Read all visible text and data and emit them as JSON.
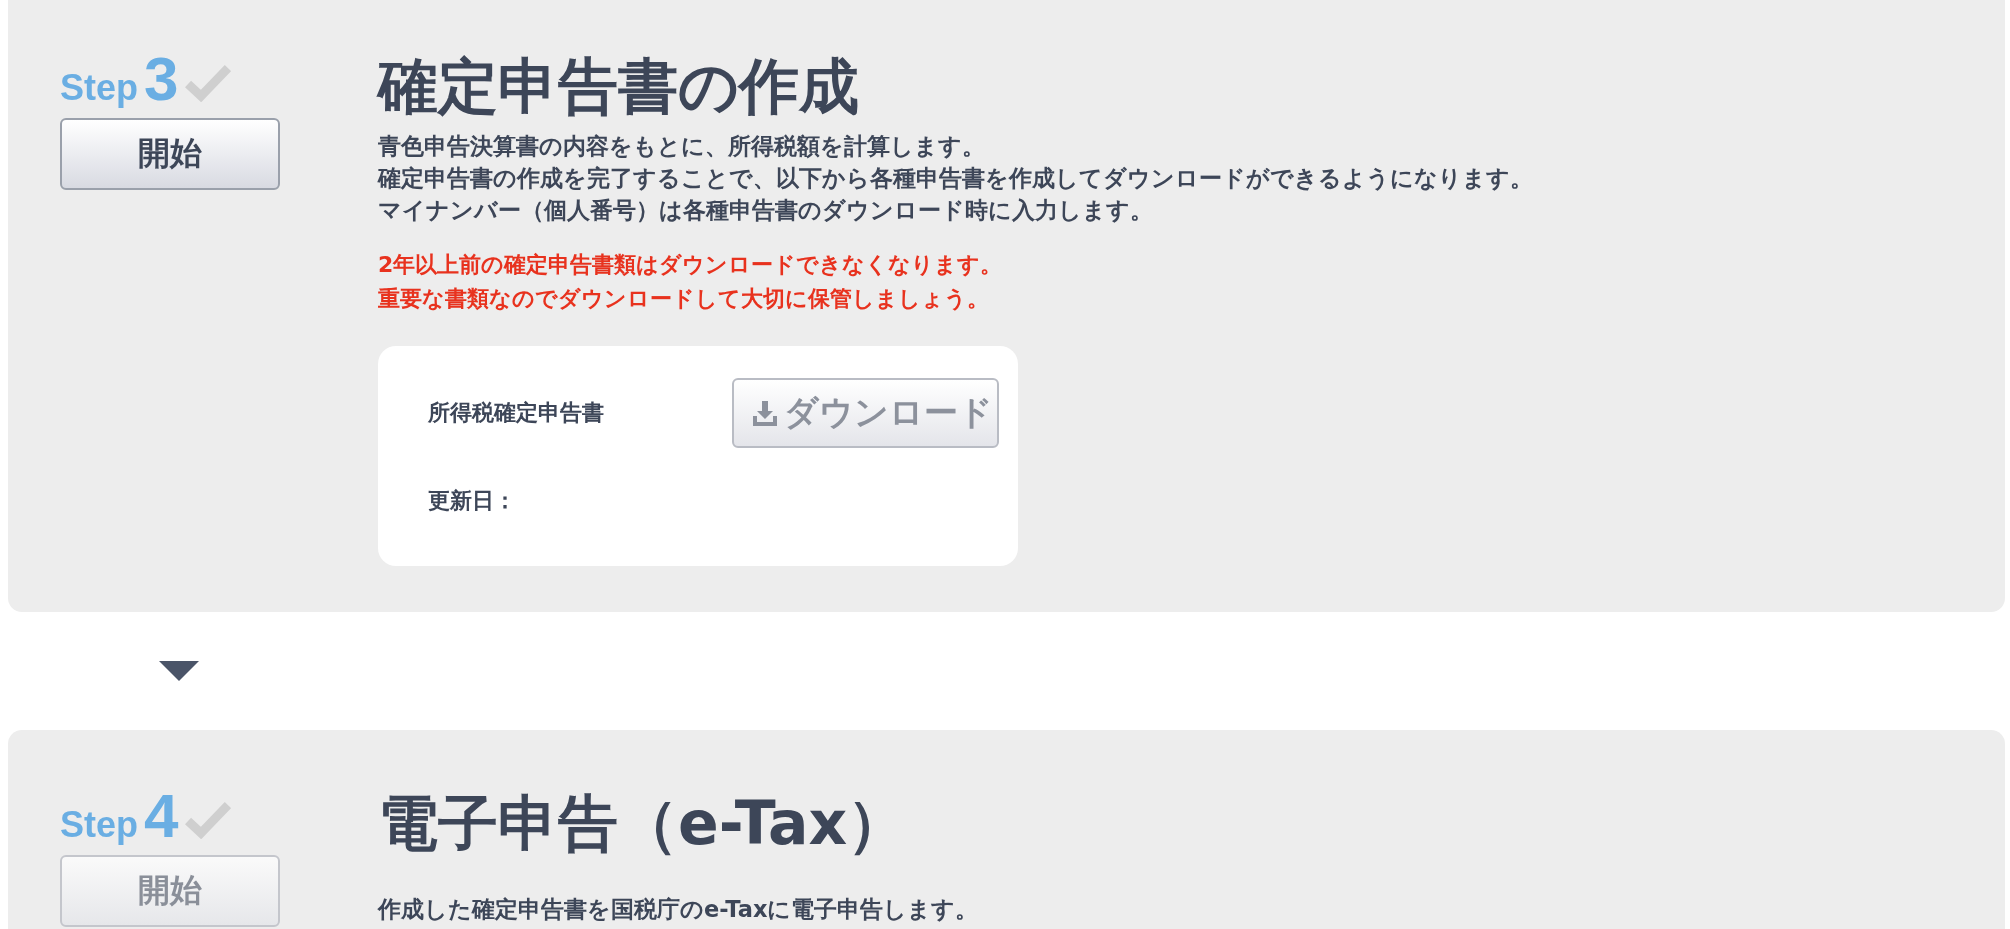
{
  "steps": [
    {
      "step_label": "Step",
      "number": "3",
      "completed": false,
      "start_button": {
        "label": "開始",
        "disabled": false
      },
      "title": "確定申告書の作成",
      "description": [
        "青色申告決算書の内容をもとに、所得税額を計算します。",
        "確定申告書の作成を完了することで、以下から各種申告書を作成してダウンロードができるようになります。",
        "マイナンバー（個人番号）は各種申告書のダウンロード時に入力します。"
      ],
      "warnings": [
        "2年以上前の確定申告書類はダウンロードできなくなります。",
        "重要な書類なのでダウンロードして大切に保管しましょう。"
      ],
      "documents": [
        {
          "name": "所得税確定申告書",
          "updated_label": "更新日：",
          "download": {
            "label": "ダウンロード",
            "disabled": true
          }
        }
      ]
    },
    {
      "step_label": "Step",
      "number": "4",
      "completed": false,
      "start_button": {
        "label": "開始",
        "disabled": true
      },
      "title": "電子申告（e-Tax）",
      "description": [
        "作成した確定申告書を国税庁のe-Taxに電子申告します。"
      ]
    }
  ]
}
